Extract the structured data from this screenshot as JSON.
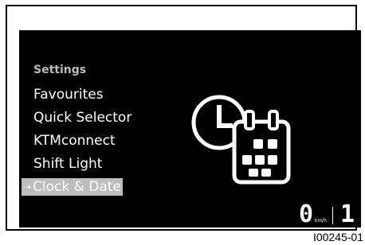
{
  "menu": {
    "title": "Settings",
    "items": [
      {
        "label": "Favourites"
      },
      {
        "label": "Quick Selector"
      },
      {
        "label": "KTMconnect"
      },
      {
        "label": "Shift Light"
      },
      {
        "label": "Clock & Date",
        "selected": true
      }
    ],
    "selected_indicator": "⇢"
  },
  "icons": {
    "main": "clock-calendar-icon"
  },
  "status": {
    "speed": "0",
    "speed_unit": "km/h",
    "gear": "1"
  },
  "figure_code": "I00245-01",
  "colors": {
    "screen_bg": "#000000",
    "text": "#ffffff",
    "title_text": "#b9b9b9",
    "selection_bg": "#bdbdbd"
  }
}
